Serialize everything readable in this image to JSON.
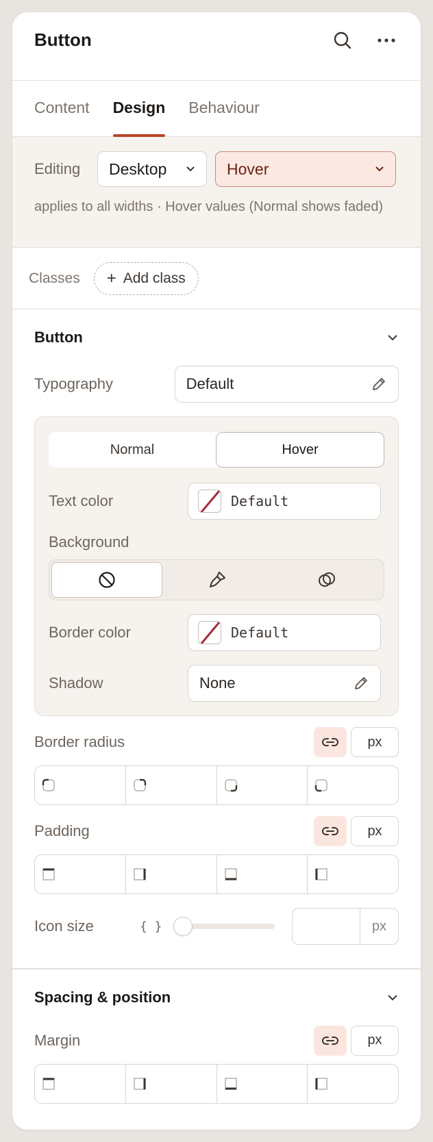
{
  "panel": {
    "title": "Button",
    "icons": [
      "search-icon",
      "more-icon"
    ]
  },
  "tabs": [
    {
      "label": "Content",
      "active": false
    },
    {
      "label": "Design",
      "active": true
    },
    {
      "label": "Behaviour",
      "active": false
    }
  ],
  "editing": {
    "label": "Editing",
    "device": "Desktop",
    "state": "Hover",
    "note": "applies to all widths · Hover values (Normal shows faded)"
  },
  "classes": {
    "label": "Classes",
    "add_label": "Add class"
  },
  "button_section": {
    "title": "Button",
    "typography": {
      "label": "Typography",
      "value": "Default"
    },
    "state_toggle": {
      "normal": "Normal",
      "hover": "Hover",
      "active": "hover"
    },
    "text_color": {
      "label": "Text color",
      "value": "Default"
    },
    "background": {
      "label": "Background",
      "options": [
        "none-icon",
        "brush-icon",
        "gradient-icon"
      ],
      "active": 0
    },
    "border_color": {
      "label": "Border color",
      "value": "Default"
    },
    "shadow": {
      "label": "Shadow",
      "value": "None"
    },
    "border_radius": {
      "label": "Border radius",
      "unit": "px"
    },
    "padding": {
      "label": "Padding",
      "unit": "px"
    },
    "icon_size": {
      "label": "Icon size",
      "token_glyph": "{ }",
      "slider_value": 0,
      "unit": "px"
    }
  },
  "spacing_section": {
    "title": "Spacing & position",
    "margin": {
      "label": "Margin",
      "unit": "px"
    }
  },
  "colors": {
    "accent": "#b8432a",
    "hover_bg": "#fbe8e2",
    "panel_tint": "#f6f2ee"
  }
}
